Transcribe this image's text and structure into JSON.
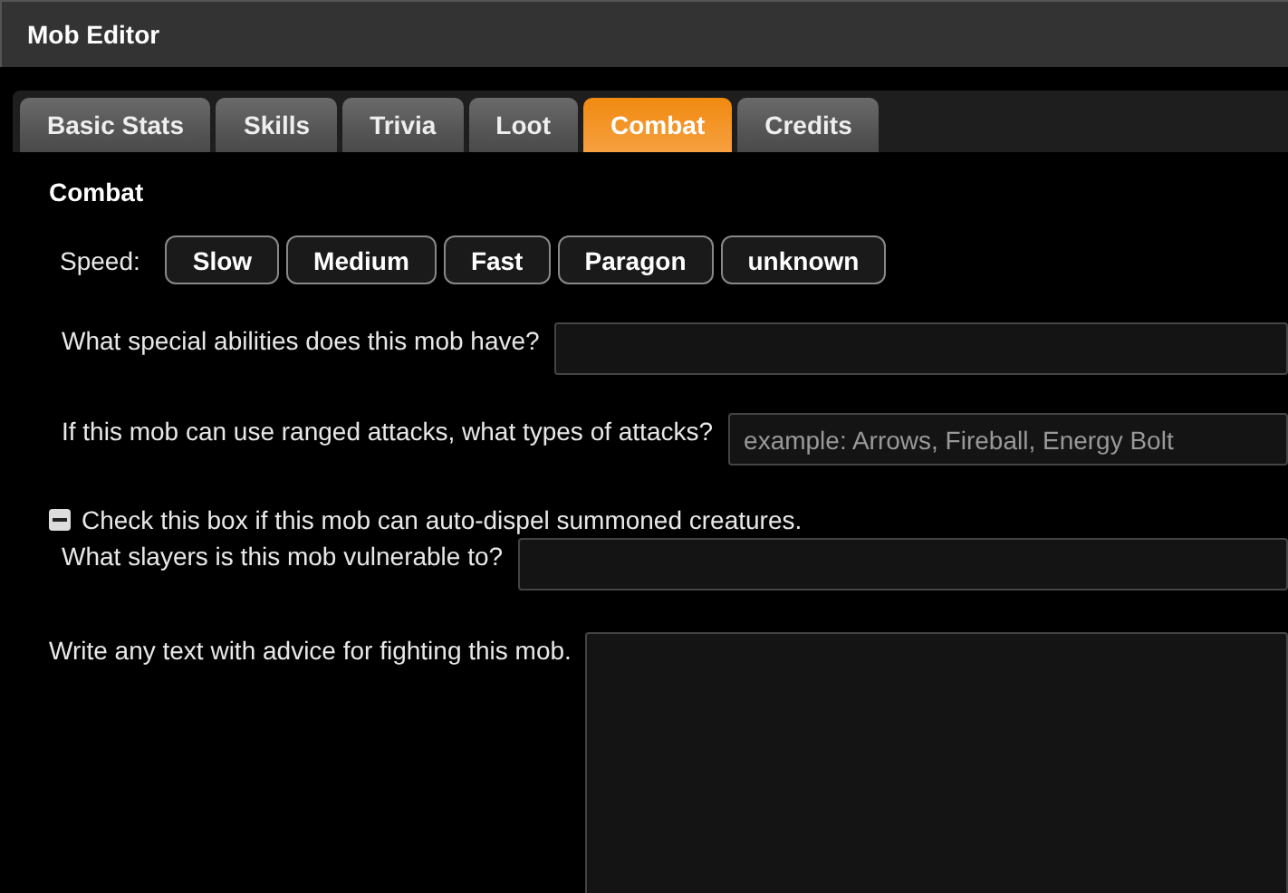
{
  "window": {
    "title": "Mob Editor"
  },
  "tabs": [
    {
      "label": "Basic Stats",
      "selected": false
    },
    {
      "label": "Skills",
      "selected": false
    },
    {
      "label": "Trivia",
      "selected": false
    },
    {
      "label": "Loot",
      "selected": false
    },
    {
      "label": "Combat",
      "selected": true
    },
    {
      "label": "Credits",
      "selected": false
    }
  ],
  "section_title": "Combat",
  "speed": {
    "label": "Speed:",
    "options": [
      {
        "label": "Slow",
        "selected": false
      },
      {
        "label": "Medium",
        "selected": false
      },
      {
        "label": "Fast",
        "selected": false
      },
      {
        "label": "Paragon",
        "selected": false
      },
      {
        "label": "unknown",
        "selected": false
      }
    ]
  },
  "special_abilities": {
    "label": "What special abilities does this mob have?"
  },
  "ranged_attacks": {
    "label": "If this mob can use ranged attacks, what types of attacks?",
    "placeholder": "example: Arrows, Fireball, Energy Bolt"
  },
  "auto_dispel": {
    "label": "Check this box if this mob can auto-dispel summoned creatures.",
    "indeterminate": true
  },
  "slayers": {
    "label": "What slayers is this mob vulnerable to?"
  },
  "advice": {
    "label": "Write any text with advice for fighting this mob."
  }
}
